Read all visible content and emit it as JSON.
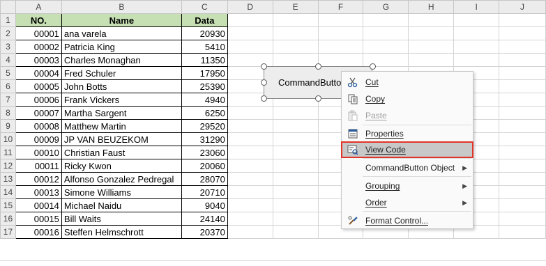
{
  "columns": [
    "A",
    "B",
    "C",
    "D",
    "E",
    "F",
    "G",
    "H",
    "I",
    "J"
  ],
  "header_row": {
    "no": "NO.",
    "name": "Name",
    "data": "Data"
  },
  "rows": [
    {
      "r": "1"
    },
    {
      "r": "2",
      "no": "00001",
      "name": "ana varela",
      "data": "20930"
    },
    {
      "r": "3",
      "no": "00002",
      "name": "Patricia King",
      "data": "5410"
    },
    {
      "r": "4",
      "no": "00003",
      "name": "Charles Monaghan",
      "data": "11350"
    },
    {
      "r": "5",
      "no": "00004",
      "name": "Fred Schuler",
      "data": "17950"
    },
    {
      "r": "6",
      "no": "00005",
      "name": "John Botts",
      "data": "25390"
    },
    {
      "r": "7",
      "no": "00006",
      "name": "Frank Vickers",
      "data": "4940"
    },
    {
      "r": "8",
      "no": "00007",
      "name": "Martha Sargent",
      "data": "6250"
    },
    {
      "r": "9",
      "no": "00008",
      "name": "Matthew Martin",
      "data": "29520"
    },
    {
      "r": "10",
      "no": "00009",
      "name": "JP VAN BEUZEKOM",
      "data": "31290"
    },
    {
      "r": "11",
      "no": "00010",
      "name": "Christian Faust",
      "data": "23060"
    },
    {
      "r": "12",
      "no": "00011",
      "name": "Ricky Kwon",
      "data": "20060"
    },
    {
      "r": "13",
      "no": "00012",
      "name": "Alfonso Gonzalez Pedregal",
      "data": "28070"
    },
    {
      "r": "14",
      "no": "00013",
      "name": "Simone Williams",
      "data": "20710"
    },
    {
      "r": "15",
      "no": "00014",
      "name": "Michael Naidu",
      "data": "9040"
    },
    {
      "r": "16",
      "no": "00015",
      "name": "Bill Waits",
      "data": "24140"
    },
    {
      "r": "17",
      "no": "00016",
      "name": "Steffen Helmschrott",
      "data": "20370"
    }
  ],
  "command_button": {
    "label": "CommandButto"
  },
  "context_menu": {
    "cut": "Cut",
    "copy": "Copy",
    "paste": "Paste",
    "properties": "Properties",
    "view_code": "View Code",
    "object": "CommandButton Object",
    "grouping": "Grouping",
    "order": "Order",
    "format_control": "Format Control..."
  },
  "colors": {
    "header_fill": "#c6e0b4",
    "highlight_border": "#e0352b"
  }
}
